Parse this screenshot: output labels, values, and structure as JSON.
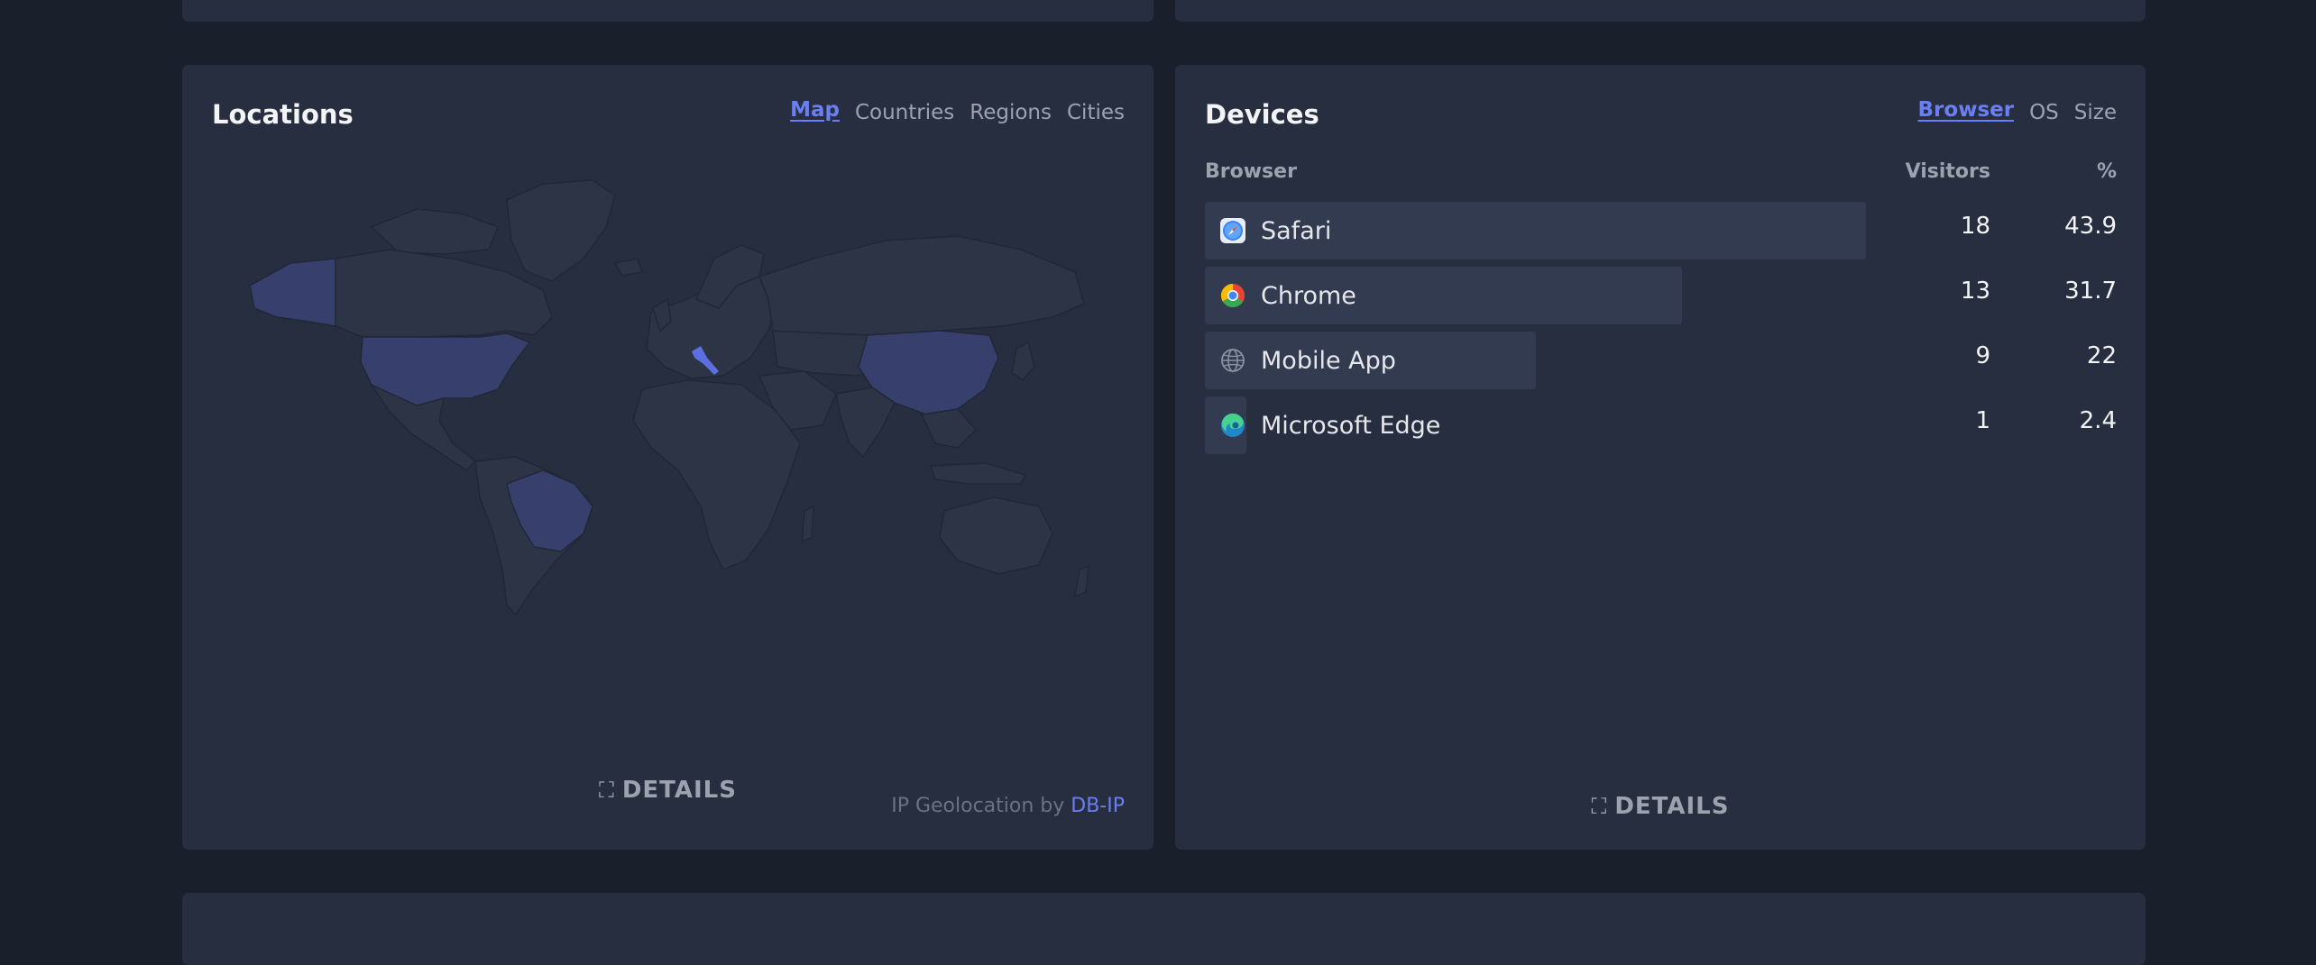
{
  "locations": {
    "title": "Locations",
    "tabs": [
      "Map",
      "Countries",
      "Regions",
      "Cities"
    ],
    "active_tab": "Map",
    "details_label": "DETAILS",
    "credit_prefix": "IP Geolocation by",
    "credit_link": "DB-IP"
  },
  "devices": {
    "title": "Devices",
    "tabs": [
      "Browser",
      "OS",
      "Size"
    ],
    "active_tab": "Browser",
    "columns": {
      "name": "Browser",
      "visitors": "Visitors",
      "percent": "%"
    },
    "rows": [
      {
        "name": "Safari",
        "visitors": "18",
        "percent": "43.9",
        "share": 1.0,
        "icon": "safari-icon"
      },
      {
        "name": "Chrome",
        "visitors": "13",
        "percent": "31.7",
        "share": 0.722,
        "icon": "chrome-icon"
      },
      {
        "name": "Mobile App",
        "visitors": "9",
        "percent": "22",
        "share": 0.5,
        "icon": "globe-icon"
      },
      {
        "name": "Microsoft Edge",
        "visitors": "1",
        "percent": "2.4",
        "share": 0.056,
        "icon": "edge-icon"
      }
    ],
    "details_label": "DETAILS"
  },
  "colors": {
    "background": "#1a1f2c",
    "card": "#262e3f",
    "accent": "#6b7ff0",
    "bar": "#323b4f"
  }
}
